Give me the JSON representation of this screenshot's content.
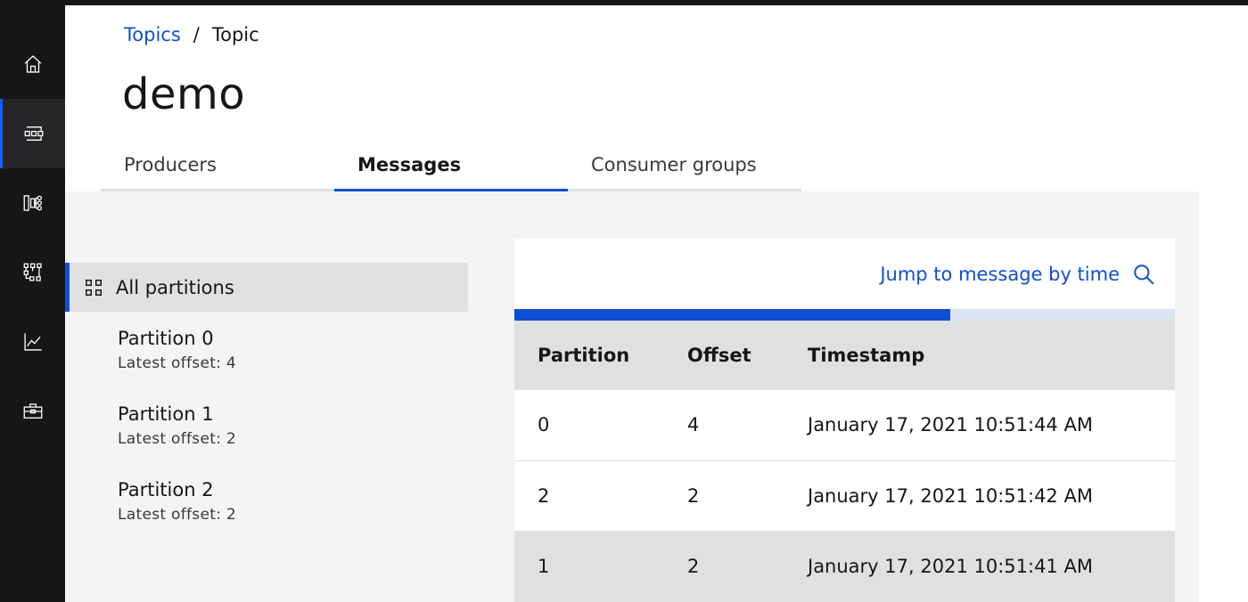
{
  "sidebar": {
    "items": [
      {
        "name": "home",
        "active": false
      },
      {
        "name": "topics",
        "active": true
      },
      {
        "name": "consumer-groups",
        "active": false
      },
      {
        "name": "schema",
        "active": false
      },
      {
        "name": "monitoring",
        "active": false
      },
      {
        "name": "toolkit",
        "active": false
      }
    ]
  },
  "breadcrumb": {
    "parent": "Topics",
    "separator": "/",
    "current": "Topic"
  },
  "page": {
    "title": "demo"
  },
  "tabs": [
    {
      "label": "Producers",
      "active": false
    },
    {
      "label": "Messages",
      "active": true
    },
    {
      "label": "Consumer groups",
      "active": false
    }
  ],
  "partitions": {
    "all_label": "All partitions",
    "items": [
      {
        "name": "Partition 0",
        "offset": "Latest offset: 4"
      },
      {
        "name": "Partition 1",
        "offset": "Latest offset: 2"
      },
      {
        "name": "Partition 2",
        "offset": "Latest offset: 2"
      }
    ]
  },
  "messages": {
    "jump_label": "Jump to message by time",
    "progress": 0.66,
    "columns": [
      "Partition",
      "Offset",
      "Timestamp"
    ],
    "rows": [
      {
        "partition": "0",
        "offset": "4",
        "timestamp": "January 17, 2021 10:51:44 AM",
        "selected": false
      },
      {
        "partition": "2",
        "offset": "2",
        "timestamp": "January 17, 2021 10:51:42 AM",
        "selected": false
      },
      {
        "partition": "1",
        "offset": "2",
        "timestamp": "January 17, 2021 10:51:41 AM",
        "selected": true
      }
    ]
  },
  "colors": {
    "accent": "#0f4fd1",
    "nav_bg": "#161616",
    "page_bg": "#f4f4f4"
  }
}
